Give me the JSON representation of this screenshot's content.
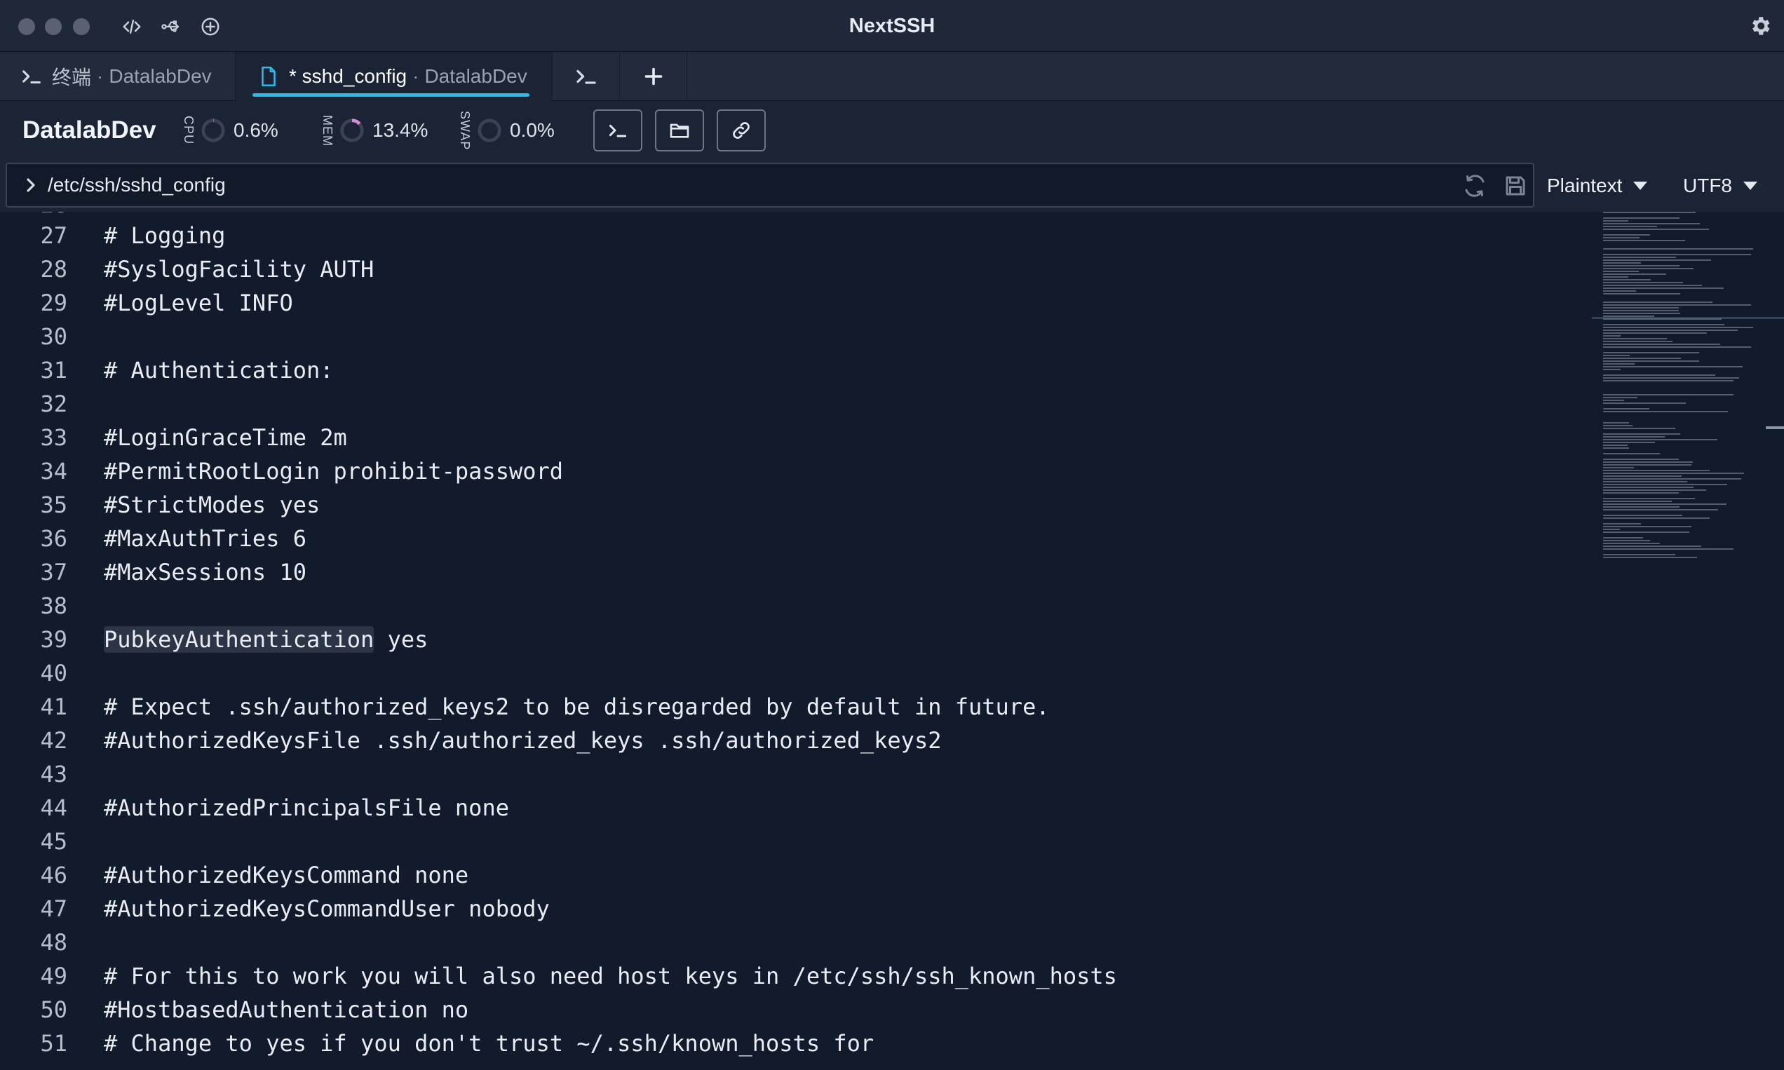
{
  "app": {
    "title": "NextSSH"
  },
  "tabs": [
    {
      "title": "终端",
      "separator": "·",
      "host": "DatalabDev",
      "icon": "terminal-icon",
      "active": false
    },
    {
      "title": "* sshd_config",
      "separator": "·",
      "host": "DatalabDev",
      "icon": "file-icon",
      "active": true
    }
  ],
  "status": {
    "host": "DatalabDev",
    "metrics": [
      {
        "label": "CPU",
        "value": "0.6%",
        "fraction": 0.006
      },
      {
        "label": "MEM",
        "value": "13.4%",
        "fraction": 0.134
      },
      {
        "label": "SWAP",
        "value": "0.0%",
        "fraction": 0.0
      }
    ]
  },
  "path": {
    "value": "/etc/ssh/sshd_config"
  },
  "editor": {
    "language": "Plaintext",
    "encoding": "UTF8",
    "highlight_line": 39,
    "highlight_token": "PubkeyAuthentication",
    "partial_top_line": "26",
    "lines": [
      {
        "n": "27",
        "text": "# Logging"
      },
      {
        "n": "28",
        "text": "#SyslogFacility AUTH"
      },
      {
        "n": "29",
        "text": "#LogLevel INFO"
      },
      {
        "n": "30",
        "text": ""
      },
      {
        "n": "31",
        "text": "# Authentication:"
      },
      {
        "n": "32",
        "text": ""
      },
      {
        "n": "33",
        "text": "#LoginGraceTime 2m"
      },
      {
        "n": "34",
        "text": "#PermitRootLogin prohibit-password"
      },
      {
        "n": "35",
        "text": "#StrictModes yes"
      },
      {
        "n": "36",
        "text": "#MaxAuthTries 6"
      },
      {
        "n": "37",
        "text": "#MaxSessions 10"
      },
      {
        "n": "38",
        "text": ""
      },
      {
        "n": "39",
        "text": "PubkeyAuthentication yes"
      },
      {
        "n": "40",
        "text": ""
      },
      {
        "n": "41",
        "text": "# Expect .ssh/authorized_keys2 to be disregarded by default in future."
      },
      {
        "n": "42",
        "text": "#AuthorizedKeysFile .ssh/authorized_keys .ssh/authorized_keys2"
      },
      {
        "n": "43",
        "text": ""
      },
      {
        "n": "44",
        "text": "#AuthorizedPrincipalsFile none"
      },
      {
        "n": "45",
        "text": ""
      },
      {
        "n": "46",
        "text": "#AuthorizedKeysCommand none"
      },
      {
        "n": "47",
        "text": "#AuthorizedKeysCommandUser nobody"
      },
      {
        "n": "48",
        "text": ""
      },
      {
        "n": "49",
        "text": "# For this to work you will also need host keys in /etc/ssh/ssh_known_hosts"
      },
      {
        "n": "50",
        "text": "#HostbasedAuthentication no"
      },
      {
        "n": "51",
        "text": "# Change to yes if you don't trust ~/.ssh/known_hosts for"
      }
    ]
  },
  "colors": {
    "accent": "#2fb9e7",
    "background": "#121b2b",
    "titlebar": "#1f2839",
    "mem_ring": "#d58ad9"
  }
}
